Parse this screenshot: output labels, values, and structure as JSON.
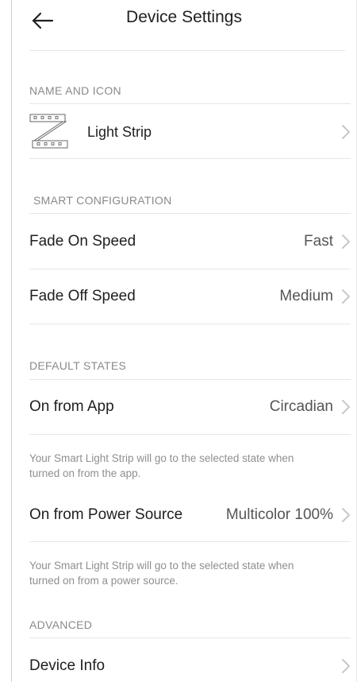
{
  "header": {
    "title": "Device Settings",
    "back_icon": "back-arrow-icon"
  },
  "sections": {
    "name_and_icon": {
      "header": "NAME AND ICON",
      "device_name": "Light Strip",
      "device_icon": "light-strip-icon"
    },
    "smart_configuration": {
      "header": "SMART CONFIGURATION",
      "fade_on": {
        "label": "Fade On Speed",
        "value": "Fast"
      },
      "fade_off": {
        "label": "Fade Off Speed",
        "value": "Medium"
      }
    },
    "default_states": {
      "header": "DEFAULT STATES",
      "on_from_app": {
        "label": "On from App",
        "value": "Circadian",
        "help": "Your Smart Light Strip will go to the selected state when turned on from the app."
      },
      "on_from_power": {
        "label": "On from Power Source",
        "value": "Multicolor 100%",
        "help": "Your Smart Light Strip will go to the selected state when turned on from a power source."
      }
    },
    "advanced": {
      "header": "ADVANCED",
      "device_info": {
        "label": "Device Info"
      }
    }
  },
  "colors": {
    "section_header": "#8a8a8a",
    "divider": "#e6e6e6",
    "chevron": "#c8c8c8",
    "text": "#1f1f1f"
  }
}
